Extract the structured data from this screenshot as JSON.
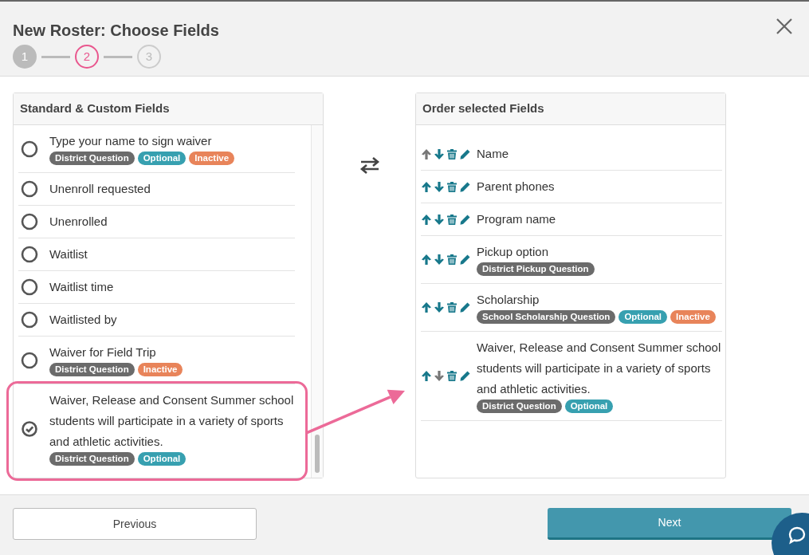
{
  "dialog": {
    "title": "New Roster: Choose Fields"
  },
  "steps": [
    {
      "label": "1",
      "complete": true,
      "selected": false
    },
    {
      "label": "2",
      "complete": false,
      "selected": true
    },
    {
      "label": "3",
      "complete": false,
      "selected": false
    }
  ],
  "available_fields": {
    "title": "Standard & Custom Fields",
    "items": [
      {
        "label": "Type your name to sign waiver",
        "selected": false,
        "highlighted": false,
        "tags": [
          {
            "text": "District Question",
            "kind": "source"
          },
          {
            "text": "Optional",
            "kind": "optional"
          },
          {
            "text": "Inactive",
            "kind": "inactive"
          }
        ]
      },
      {
        "label": "Unenroll requested",
        "selected": false,
        "highlighted": false
      },
      {
        "label": "Unenrolled",
        "selected": false,
        "highlighted": false
      },
      {
        "label": "Waitlist",
        "selected": false,
        "highlighted": false
      },
      {
        "label": "Waitlist time",
        "selected": false,
        "highlighted": false
      },
      {
        "label": "Waitlisted by",
        "selected": false,
        "highlighted": false
      },
      {
        "label": "Waiver for Field Trip",
        "selected": false,
        "highlighted": false,
        "tags": [
          {
            "text": "District Question",
            "kind": "source"
          },
          {
            "text": "Inactive",
            "kind": "inactive"
          }
        ]
      },
      {
        "label": "Waiver, Release and Consent Summer school students will participate in a variety of sports and athletic activities.",
        "selected": true,
        "highlighted": true,
        "tags": [
          {
            "text": "District Question",
            "kind": "source"
          },
          {
            "text": "Optional",
            "kind": "optional"
          }
        ]
      }
    ]
  },
  "selected_fields": {
    "title": "Order selected Fields",
    "items": [
      {
        "label": "Name",
        "up_disabled": true,
        "down_disabled": false
      },
      {
        "label": "Parent phones",
        "up_disabled": false,
        "down_disabled": false
      },
      {
        "label": "Program name",
        "up_disabled": false,
        "down_disabled": false
      },
      {
        "label": "Pickup option",
        "up_disabled": false,
        "down_disabled": false,
        "tags": [
          {
            "text": "District Pickup Question",
            "kind": "source"
          }
        ]
      },
      {
        "label": "Scholarship",
        "up_disabled": false,
        "down_disabled": false,
        "tags": [
          {
            "text": "School Scholarship Question",
            "kind": "source"
          },
          {
            "text": "Optional",
            "kind": "optional"
          },
          {
            "text": "Inactive",
            "kind": "inactive"
          }
        ]
      },
      {
        "label": "Waiver, Release and Consent Summer school students will participate in a variety of sports and athletic activities.",
        "up_disabled": false,
        "down_disabled": true,
        "tags": [
          {
            "text": "District Question",
            "kind": "source"
          },
          {
            "text": "Optional",
            "kind": "optional"
          }
        ]
      }
    ]
  },
  "buttons": [
    {
      "label": "Previous",
      "kind": "secondary"
    },
    {
      "label": "Next",
      "kind": "primary"
    }
  ]
}
